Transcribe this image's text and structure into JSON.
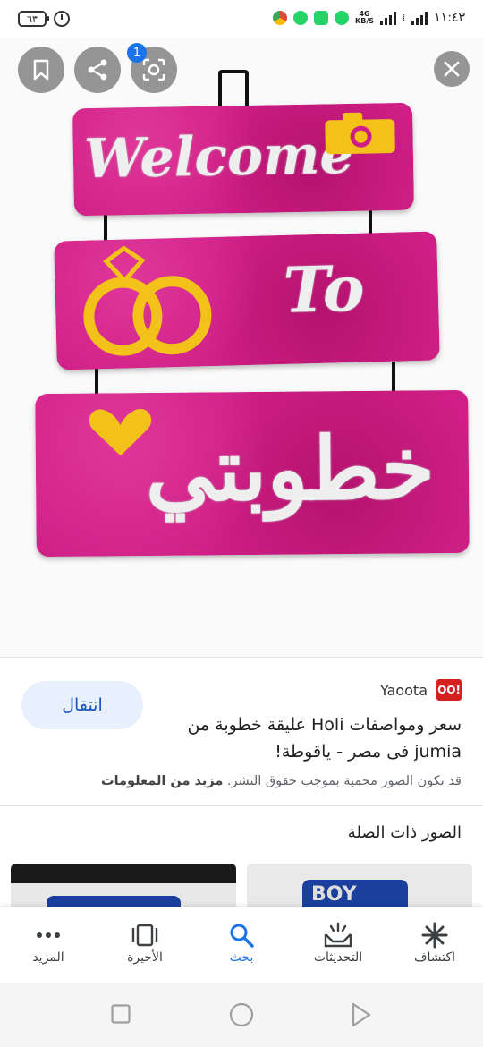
{
  "status_bar": {
    "battery": "٦٣",
    "time": "١١:٤٣",
    "network_speed": "KB/S",
    "network_type": "4G"
  },
  "image_viewer": {
    "badge_count": "1",
    "board_text_top": "Welcome",
    "board_text_middle": "To",
    "board_text_bottom": "خطوبتي"
  },
  "info_panel": {
    "source_logo": "OO!",
    "source_name": "Yaoota",
    "visit_button": "انتقال",
    "title": "سعر ومواصفات Holi عليقة خطوبة من jumia فى مصر - ياقوطة!",
    "copyright_note": "قد تكون الصور محمية بموجب حقوق النشر.",
    "more_info_link": "مزيد من المعلومات"
  },
  "related": {
    "title": "الصور ذات الصلة"
  },
  "bottom_nav": {
    "items": [
      {
        "label": "المزيد",
        "icon": "more-icon"
      },
      {
        "label": "الأخيرة",
        "icon": "recent-icon"
      },
      {
        "label": "بحث",
        "icon": "search-icon"
      },
      {
        "label": "التحديثات",
        "icon": "updates-icon"
      },
      {
        "label": "اكتشاف",
        "icon": "discover-icon"
      }
    ]
  },
  "colors": {
    "accent": "#1a73e8",
    "board_pink": "#cf1f86",
    "visit_button_bg": "#e8f0fe"
  }
}
